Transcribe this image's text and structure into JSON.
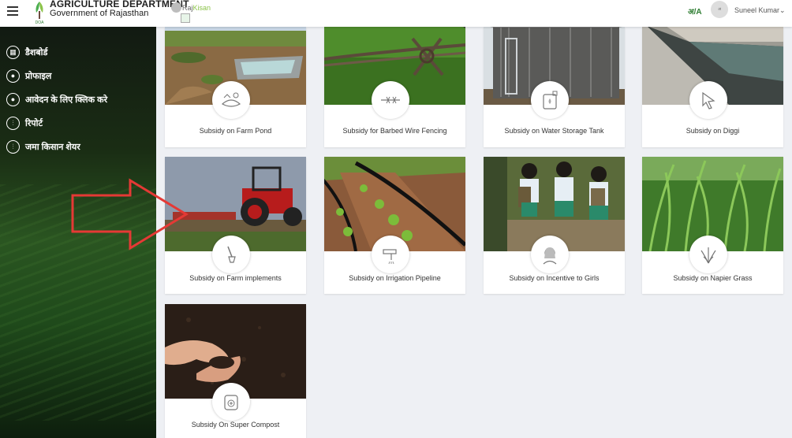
{
  "header": {
    "brand_title": "AGRICULTURE DEPARTMENT",
    "brand_subtitle": "Government of Rajasthan",
    "logo_caption": "DOA",
    "rajkisan_part1": "Raj",
    "rajkisan_part2": "Kisan",
    "lang_toggle": "अ/A",
    "user_name": "Suneel Kumar",
    "avatar_text": "अ"
  },
  "sidebar": {
    "items": [
      {
        "label": "डैशबोर्ड",
        "icon": "dashboard-icon"
      },
      {
        "label": "प्रोफाइल",
        "icon": "person-icon"
      },
      {
        "label": "आवेदन के लिए क्लिक करे",
        "icon": "person-icon"
      },
      {
        "label": "रिपोर्ट",
        "icon": "sliders-icon"
      },
      {
        "label": "जमा किसान शेयर",
        "icon": "sliders-icon"
      }
    ]
  },
  "cards": [
    {
      "title": "Subsidy on Farm Pond",
      "icon": "farm-pond-icon"
    },
    {
      "title": "Subsidy for Barbed Wire Fencing",
      "icon": "barbed-wire-icon"
    },
    {
      "title": "Subsidy on Water Storage Tank",
      "icon": "water-tank-icon"
    },
    {
      "title": "Subsidy on Diggi",
      "icon": "diggi-icon"
    },
    {
      "title": "Subsidy on Farm implements",
      "icon": "farm-implement-icon"
    },
    {
      "title": "Subsidy on Irrigation Pipeline",
      "icon": "irrigation-pipeline-icon"
    },
    {
      "title": "Subsidy on Incentive to Girls",
      "icon": "girl-icon"
    },
    {
      "title": "Subsidy on Napier Grass",
      "icon": "grass-icon"
    },
    {
      "title": "Subsidy On Super Compost",
      "icon": "compost-icon"
    }
  ],
  "colors": {
    "accent_green": "#2e7d32",
    "kisan_green": "#8bc34a",
    "arrow_red": "#e53935"
  }
}
